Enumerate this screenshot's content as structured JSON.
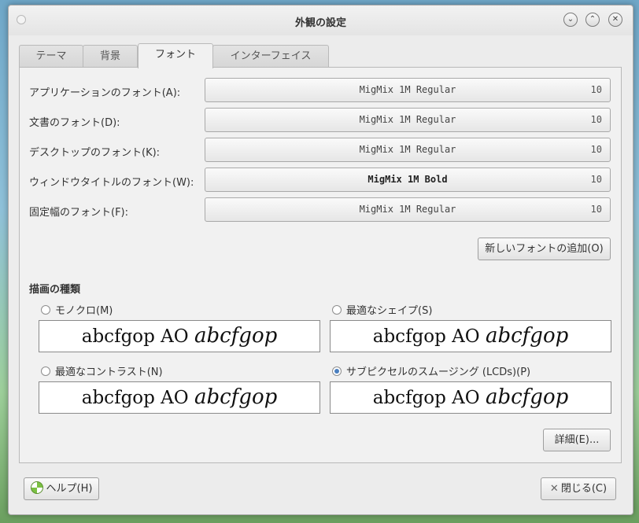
{
  "window": {
    "title": "外観の設定",
    "controls": {
      "minimize": "⌄",
      "maximize": "⌃",
      "close": "✕"
    }
  },
  "tabs": [
    {
      "label": "テーマ",
      "active": false
    },
    {
      "label": "背景",
      "active": false
    },
    {
      "label": "フォント",
      "active": true
    },
    {
      "label": "インターフェイス",
      "active": false
    }
  ],
  "fonts": {
    "application": {
      "label": "アプリケーションのフォント(A):",
      "name": "MigMix 1M Regular",
      "size": "10"
    },
    "document": {
      "label": "文書のフォント(D):",
      "name": "MigMix 1M Regular",
      "size": "10"
    },
    "desktop": {
      "label": "デスクトップのフォント(K):",
      "name": "MigMix 1M Regular",
      "size": "10"
    },
    "window_title": {
      "label": "ウィンドウタイトルのフォント(W):",
      "name": "MigMix 1M Bold",
      "size": "10"
    },
    "fixed": {
      "label": "固定幅のフォント(F):",
      "name": "MigMix 1M Regular",
      "size": "10"
    }
  },
  "add_font_button": "新しいフォントの追加(O)",
  "rendering": {
    "title": "描画の種類",
    "options": [
      {
        "label": "モノクロ(M)",
        "checked": false,
        "sample_regular": "abcfgop AO",
        "sample_italic": "abcfgop"
      },
      {
        "label": "最適なシェイプ(S)",
        "checked": false,
        "sample_regular": "abcfgop AO",
        "sample_italic": "abcfgop"
      },
      {
        "label": "最適なコントラスト(N)",
        "checked": false,
        "sample_regular": "abcfgop AO",
        "sample_italic": "abcfgop"
      },
      {
        "label": "サブピクセルのスムージング (LCDs)(P)",
        "checked": true,
        "sample_regular": "abcfgop AO",
        "sample_italic": "abcfgop"
      }
    ]
  },
  "details_button": "詳細(E)...",
  "help_button": "ヘルプ(H)",
  "close_button": "閉じる(C)",
  "icons": {
    "help": "help-icon",
    "close": "close-icon"
  },
  "colors": {
    "radio_checked": "#4a7fbf"
  }
}
